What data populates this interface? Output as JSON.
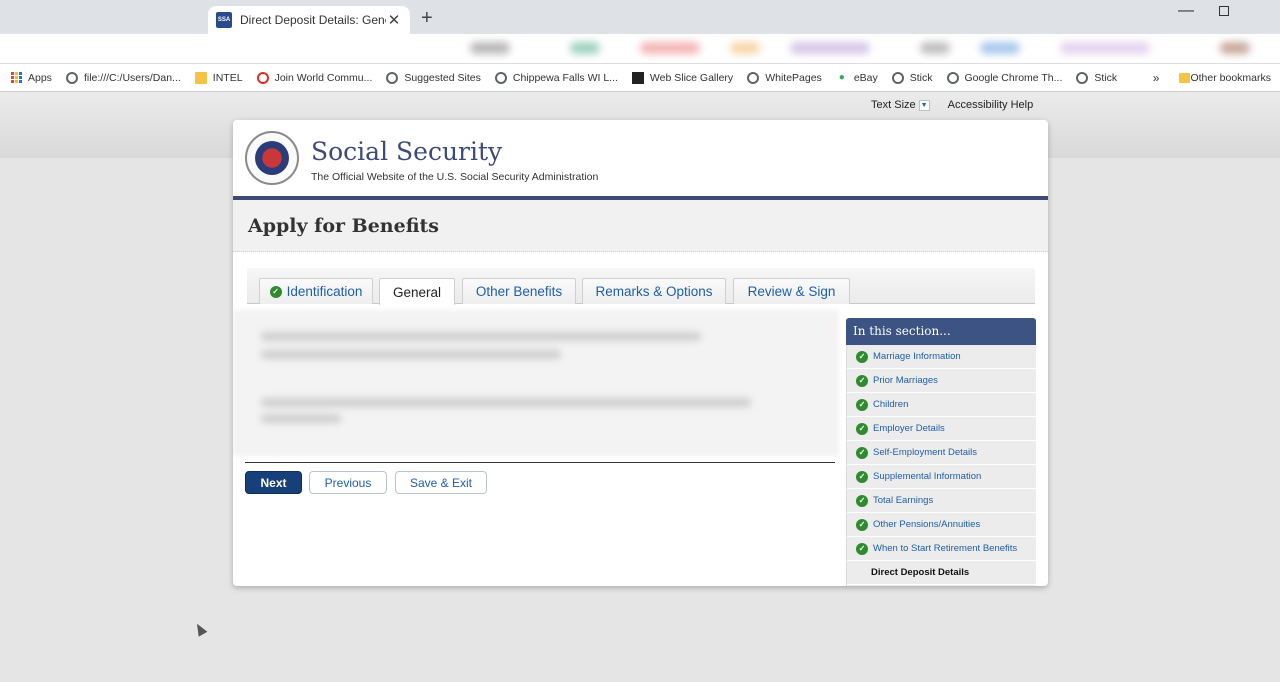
{
  "browser": {
    "tab_title": "Direct Deposit Details: General, A",
    "favicon_text": "SSA",
    "close_glyph": "✕",
    "new_tab_glyph": "+",
    "minimize_glyph": "—",
    "bookmarks": [
      {
        "label": "Apps",
        "icon": "apps-grid-icon"
      },
      {
        "label": "file:///C:/Users/Dan...",
        "icon": "globe-icon"
      },
      {
        "label": "INTEL",
        "icon": "folder-icon"
      },
      {
        "label": "Join World Commu...",
        "icon": "world-icon"
      },
      {
        "label": "Suggested Sites",
        "icon": "globe-icon"
      },
      {
        "label": "Chippewa Falls WI L...",
        "icon": "globe-icon"
      },
      {
        "label": "Web Slice Gallery",
        "icon": "web-slice-icon"
      },
      {
        "label": "WhitePages",
        "icon": "globe-icon"
      },
      {
        "label": "eBay",
        "icon": "location-icon"
      },
      {
        "label": "Stick",
        "icon": "globe-icon"
      },
      {
        "label": "Google Chrome Th...",
        "icon": "globe-icon"
      },
      {
        "label": "Stick",
        "icon": "globe-icon"
      }
    ],
    "overflow_glyph": "»",
    "other_bookmarks": "Other bookmarks"
  },
  "utility": {
    "text_size": "Text Size",
    "accessibility_help": "Accessibility Help"
  },
  "header": {
    "brand_title": "Social Security",
    "brand_subtitle": "The Official Website of the U.S. Social Security Administration"
  },
  "page": {
    "title": "Apply for Benefits"
  },
  "tabs": [
    {
      "label": "Identification",
      "completed": true
    },
    {
      "label": "General",
      "active": true
    },
    {
      "label": "Other Benefits"
    },
    {
      "label": "Remarks & Options"
    },
    {
      "label": "Review & Sign"
    }
  ],
  "buttons": {
    "next": "Next",
    "previous": "Previous",
    "save_exit": "Save & Exit"
  },
  "sidebar": {
    "heading": "In this section...",
    "items": [
      {
        "label": "Marriage Information",
        "completed": true
      },
      {
        "label": "Prior Marriages",
        "completed": true
      },
      {
        "label": "Children",
        "completed": true
      },
      {
        "label": "Employer Details",
        "completed": true
      },
      {
        "label": "Self-Employment Details",
        "completed": true
      },
      {
        "label": "Supplemental Information",
        "completed": true
      },
      {
        "label": "Total Earnings",
        "completed": true
      },
      {
        "label": "Other Pensions/Annuities",
        "completed": true
      },
      {
        "label": "When to Start Retirement Benefits",
        "completed": true
      },
      {
        "label": "Direct Deposit Details",
        "current": true
      }
    ]
  },
  "colors": {
    "brand_navy": "#3c4a78",
    "link_blue": "#1f5ea8",
    "check_green": "#2e8b2e",
    "next_button": "#173f7a"
  }
}
